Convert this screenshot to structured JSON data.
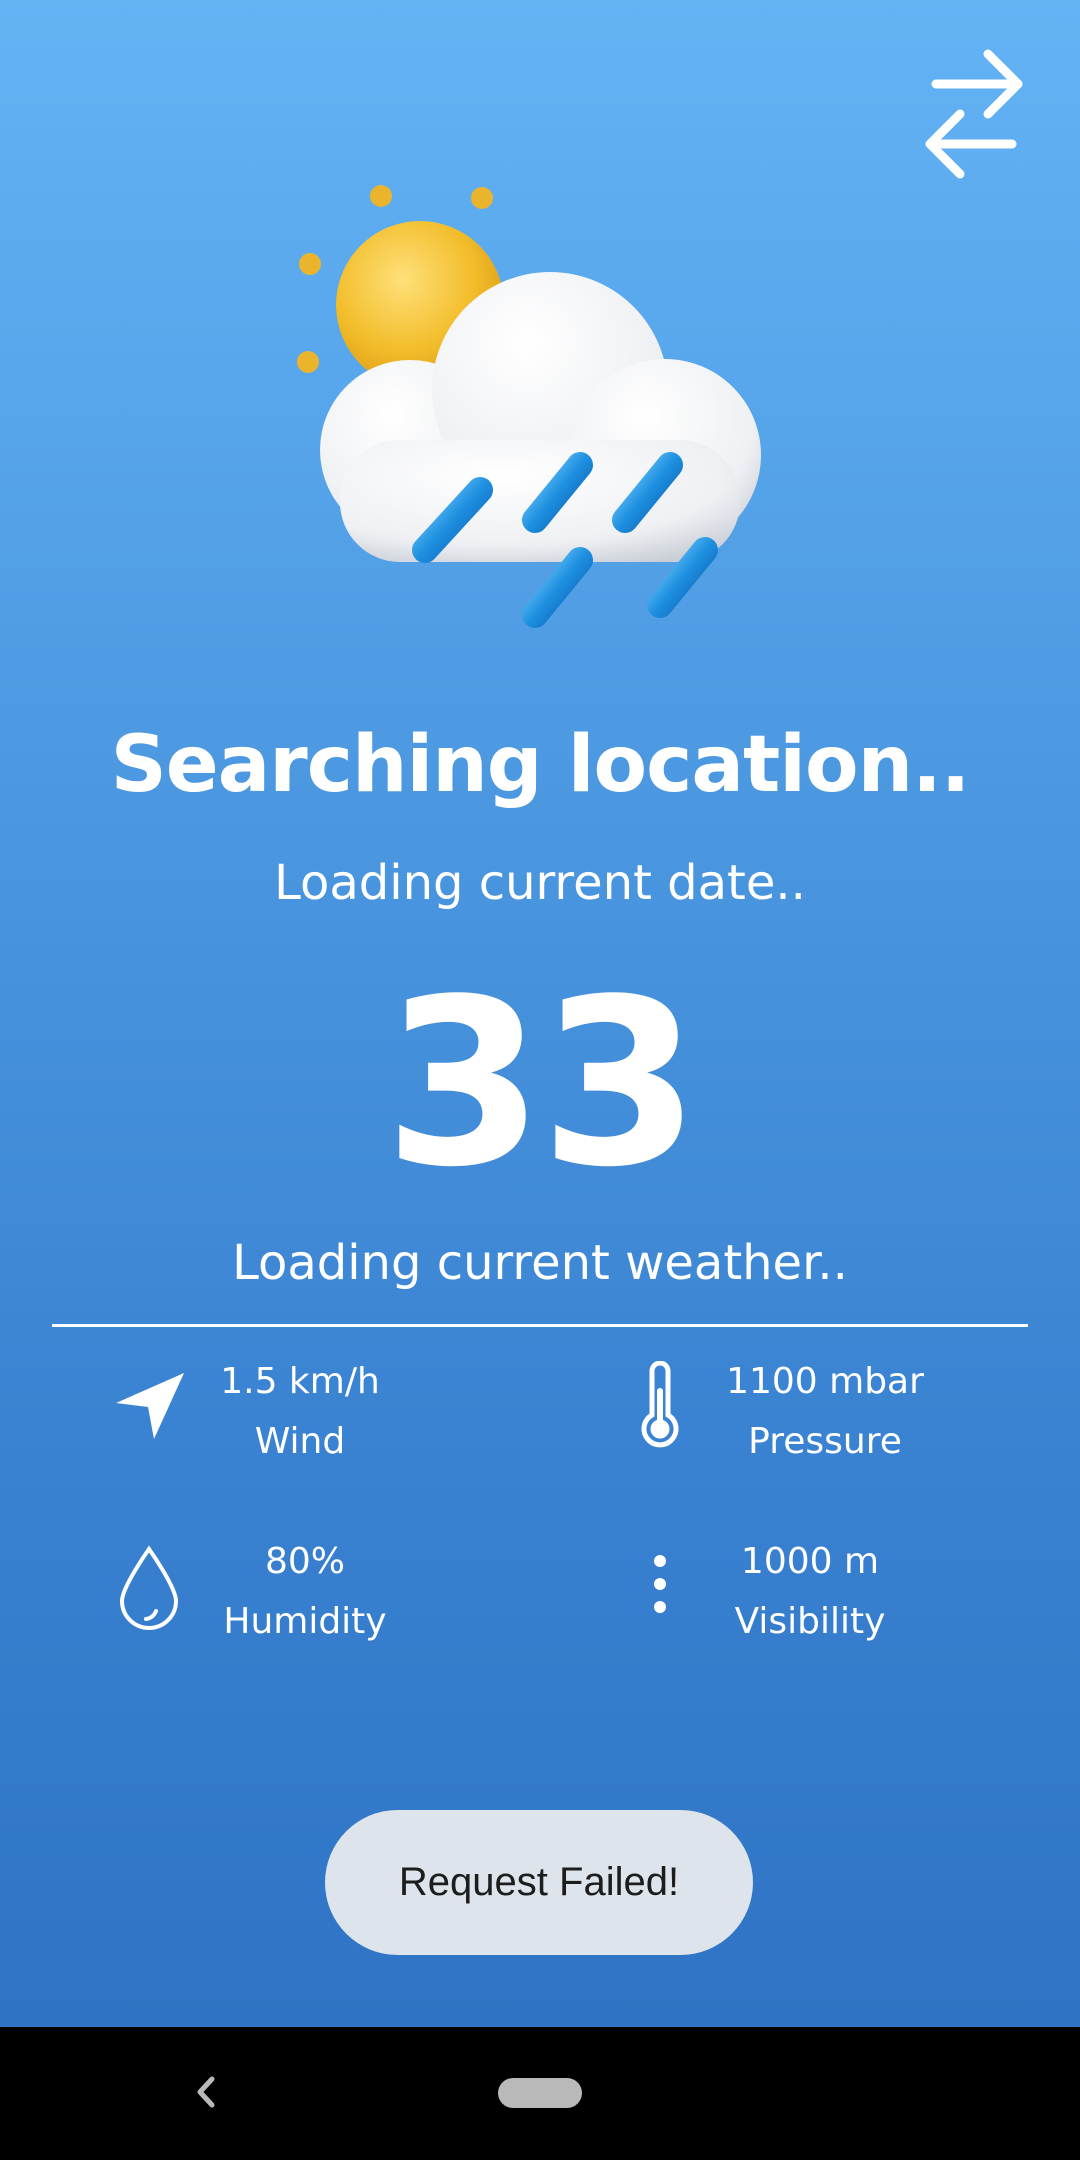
{
  "header": {
    "swap_icon": "swap-arrows-icon"
  },
  "hero": {
    "icon": "sun-cloud-rain-icon"
  },
  "location": {
    "title": "Searching location..",
    "date": "Loading current date.."
  },
  "temperature": {
    "value": "33",
    "description": "Loading current weather.."
  },
  "stats": {
    "wind": {
      "value": "1.5 km/h",
      "label": "Wind",
      "icon": "navigation-arrow-icon"
    },
    "pressure": {
      "value": "1100 mbar",
      "label": "Pressure",
      "icon": "thermometer-icon"
    },
    "humidity": {
      "value": "80%",
      "label": "Humidity",
      "icon": "water-drop-icon"
    },
    "visibility": {
      "value": "1000 m",
      "label": "Visibility",
      "icon": "dots-vertical-icon"
    }
  },
  "toast": {
    "message": "Request Failed!"
  },
  "system_nav": {
    "back_icon": "back-chevron-icon",
    "home_icon": "home-pill-icon"
  },
  "colors": {
    "bg_top": "#63b3f5",
    "bg_bottom": "#2f73c4",
    "toast_bg": "#dde4ec",
    "sun": "#f2bd2a",
    "rain": "#1e8fe0"
  }
}
